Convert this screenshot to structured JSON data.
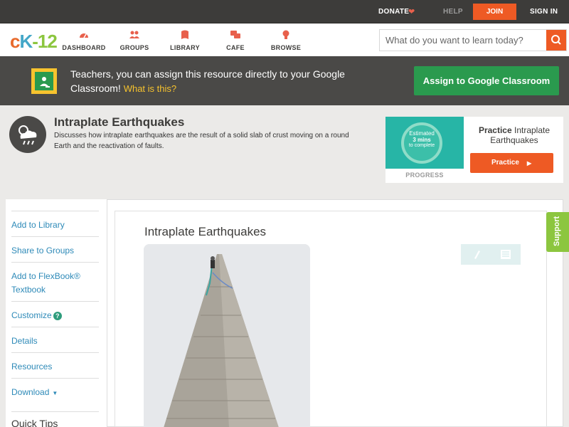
{
  "topbar": {
    "donate": "DONATE",
    "help": "HELP",
    "join": "JOIN",
    "signin": "SIGN IN"
  },
  "nav": {
    "logo": {
      "c": "c",
      "k": "K",
      "dash": "-",
      "num": "12"
    },
    "items": [
      {
        "label": "DASHBOARD",
        "icon": "speedometer-icon"
      },
      {
        "label": "GROUPS",
        "icon": "groups-icon"
      },
      {
        "label": "LIBRARY",
        "icon": "library-icon"
      },
      {
        "label": "CAFE",
        "icon": "chat-bubbles-icon"
      },
      {
        "label": "BROWSE",
        "icon": "lightbulb-icon"
      }
    ],
    "search_placeholder": "What do you want to learn today?"
  },
  "banner": {
    "text": "Teachers, you can assign this resource directly to your Google Classroom!",
    "what": "What is this?",
    "button": "Assign to Google Classroom"
  },
  "header": {
    "title": "Intraplate Earthquakes",
    "description": "Discusses how intraplate earthquakes are the result of a solid slab of crust moving on a round Earth and the reactivation of faults.",
    "progress": {
      "estimated": "Estimated",
      "mins": "3 mins",
      "complete": "to complete",
      "label": "PROGRESS"
    },
    "practice": {
      "bold": "Practice",
      "rest": "Intraplate Earthquakes",
      "button": "Practice"
    }
  },
  "sidebar": {
    "items": [
      {
        "label": "Add to Library"
      },
      {
        "label": "Share to Groups"
      },
      {
        "label": "Add to FlexBook® Textbook"
      },
      {
        "label": "Customize"
      },
      {
        "label": "Details"
      },
      {
        "label": "Resources"
      },
      {
        "label": "Download"
      }
    ],
    "quick_tips": "Quick Tips"
  },
  "article": {
    "title": "Intraplate Earthquakes"
  },
  "support": "Support",
  "colors": {
    "orange": "#ee5a24",
    "green": "#2a9a4e",
    "teal": "#27b5a6",
    "link": "#2e8ab8",
    "support": "#8cc63f"
  }
}
